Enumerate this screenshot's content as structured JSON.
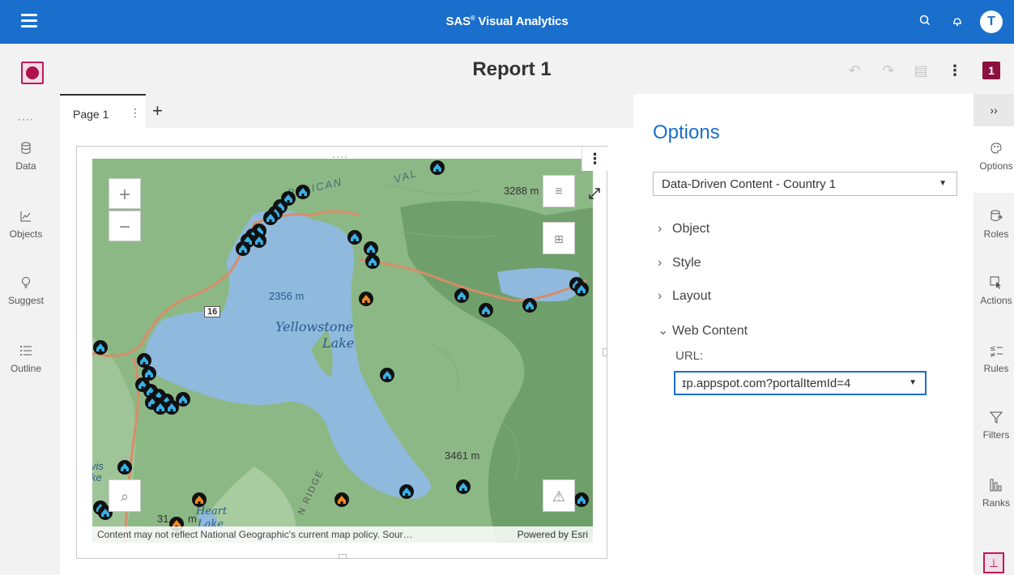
{
  "app": {
    "title": "SAS",
    "title_suffix": " Visual Analytics",
    "reg_mark": "®",
    "user_initial": "T"
  },
  "report": {
    "title": "Report 1",
    "badge": "1"
  },
  "left_nav": {
    "more": "····",
    "items": [
      {
        "label": "Data",
        "icon": "database-icon"
      },
      {
        "label": "Objects",
        "icon": "chart-icon"
      },
      {
        "label": "Suggest",
        "icon": "lightbulb-icon"
      },
      {
        "label": "Outline",
        "icon": "list-icon"
      }
    ]
  },
  "tabs": {
    "page1": "Page 1",
    "add": "+"
  },
  "map": {
    "labels": {
      "elev1": "3288 m",
      "elev2": "2356 m",
      "elev3": "3461 m",
      "elev4": "31",
      "elev4b": "m",
      "route": "16",
      "pelican": "PELICAN",
      "valley": "VAL",
      "lake1": "Yellowstone",
      "lake2": "Lake",
      "heart1": "Heart",
      "heart2": "Lake",
      "ridge": "N RIDGE",
      "vis": "vis",
      "ke": "ke"
    },
    "attribution": "Content may not reflect National Geographic's current map policy. Sour…",
    "powered_by": "Powered by Esri"
  },
  "options": {
    "title": "Options",
    "selected_object": "Data-Driven Content - Country 1",
    "sections": [
      {
        "label": "Object",
        "expanded": false
      },
      {
        "label": "Style",
        "expanded": false
      },
      {
        "label": "Layout",
        "expanded": false
      },
      {
        "label": "Web Content",
        "expanded": true
      }
    ],
    "url_label": "URL:",
    "url_value": "ɪp.appspot.com?portalItemId=4"
  },
  "right_nav": {
    "collapse": "››",
    "items": [
      {
        "label": "Options",
        "icon": "palette-icon"
      },
      {
        "label": "Roles",
        "icon": "roles-icon"
      },
      {
        "label": "Actions",
        "icon": "cursor-icon"
      },
      {
        "label": "Rules",
        "icon": "rules-icon"
      },
      {
        "label": "Filters",
        "icon": "filter-icon"
      },
      {
        "label": "Ranks",
        "icon": "ranks-icon"
      }
    ]
  },
  "colors": {
    "accent": "#1a6ecc",
    "brand": "#8b0f3f",
    "lake": "#8fb9dd",
    "land": "#8cb885",
    "road": "#d98c6a"
  }
}
